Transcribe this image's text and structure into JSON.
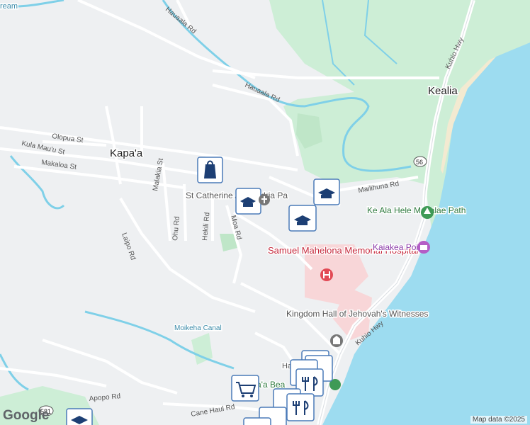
{
  "map": {
    "towns": [
      "Kapa'a",
      "Kealia"
    ],
    "roads": [
      "Hauaala Rd",
      "Olopua St",
      "Kula Mau'u St",
      "Makaloa St",
      "Malakia St",
      "Ohu Rd",
      "Hekili Rd",
      "Moa Rd",
      "Laipo Rd",
      "Mailihuna Rd",
      "Kuhio Hwy",
      "Apopo Rd",
      "Cane Haul Rd"
    ],
    "places": {
      "church": "St Catherine Alexandria Pa",
      "hospital": "Samuel Mahelona Memorial Hospital",
      "hall": "Kingdom Hall of Jehovah's Witnesses",
      "park": "Ke Ala Hele Makalae Path",
      "point": "Kaiakea Point",
      "canal": "Moikeha Canal",
      "beach": "a'a Bea",
      "stream": "ream",
      "ha": "Ha"
    },
    "route_shields": [
      "56",
      "581"
    ],
    "attribution": "Map data ©2025",
    "logo": "Google",
    "colors": {
      "water": "#9ddcf0",
      "green": "#cdeed6",
      "road": "#ffffff",
      "land": "#eef0f2",
      "river": "#7fd0e8",
      "hospital": "#f8d6d8",
      "poi_blue": "#4a7ab8"
    }
  }
}
